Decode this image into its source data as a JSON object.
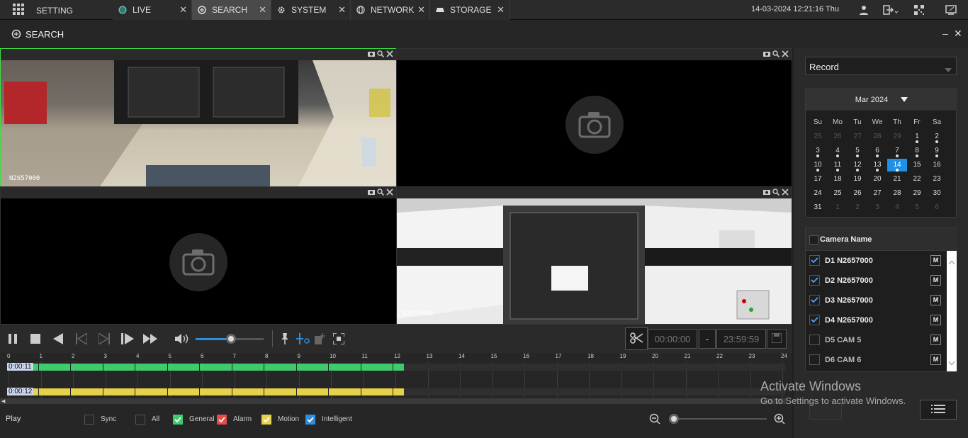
{
  "topbar": {
    "setting_label": "SETTING",
    "tabs": [
      {
        "label": "LIVE"
      },
      {
        "label": "SEARCH"
      },
      {
        "label": "SYSTEM"
      },
      {
        "label": "NETWORK"
      },
      {
        "label": "STORAGE"
      }
    ],
    "close_glyph": "✕",
    "datetime": "14-03-2024 12:21:16 Thu"
  },
  "title": "SEARCH",
  "window_controls": {
    "minimize": "–",
    "close": "✕"
  },
  "video": {
    "cell1_osd": "N2657000",
    "cell4_osd": "N2657000"
  },
  "playback": {
    "start_time": "00:00:00",
    "separator": "-",
    "end_time": "23:59:59"
  },
  "timeline": {
    "hours": [
      "0",
      "1",
      "2",
      "3",
      "4",
      "5",
      "6",
      "7",
      "8",
      "9",
      "10",
      "11",
      "12",
      "13",
      "14",
      "15",
      "16",
      "17",
      "18",
      "19",
      "20",
      "21",
      "22",
      "23",
      "24"
    ],
    "row1_label": "0:00:11",
    "row2_label": "0:00:12",
    "row1_color": "#3ecb6e",
    "row2_color": "#e6d24a",
    "row1_end_hour": 12.35,
    "row2_end_hour": 12.35
  },
  "bottombar": {
    "play_label": "Play",
    "filters": [
      {
        "label": "Sync",
        "checked": false,
        "color": ""
      },
      {
        "label": "All",
        "checked": false,
        "color": ""
      },
      {
        "label": "General",
        "checked": true,
        "color": "#3ecb6e"
      },
      {
        "label": "Alarm",
        "checked": true,
        "color": "#e84a4a"
      },
      {
        "label": "Motion",
        "checked": true,
        "color": "#e6d24a"
      },
      {
        "label": "Intelligent",
        "checked": true,
        "color": "#2e8ede"
      }
    ],
    "zoom_level": 0
  },
  "right": {
    "record_type": "Record",
    "calendar": {
      "month": "Mar 2024",
      "weekdays": [
        "Su",
        "Mo",
        "Tu",
        "We",
        "Th",
        "Fr",
        "Sa"
      ],
      "weeks": [
        [
          "25",
          "26",
          "27",
          "28",
          "29",
          "1",
          "2"
        ],
        [
          "3",
          "4",
          "5",
          "6",
          "7",
          "8",
          "9"
        ],
        [
          "10",
          "11",
          "12",
          "13",
          "14",
          "15",
          "16"
        ],
        [
          "17",
          "18",
          "19",
          "20",
          "21",
          "22",
          "23"
        ],
        [
          "24",
          "25",
          "26",
          "27",
          "28",
          "29",
          "30"
        ],
        [
          "31",
          "1",
          "2",
          "3",
          "4",
          "5",
          "6"
        ]
      ],
      "selected_day": "14",
      "accent": "#1e90e6"
    },
    "camera_header": "Camera Name",
    "cameras": [
      {
        "name": "D1 N2657000",
        "checked": true,
        "m": "M"
      },
      {
        "name": "D2 N2657000",
        "checked": true,
        "m": "M"
      },
      {
        "name": "D3 N2657000",
        "checked": true,
        "m": "M"
      },
      {
        "name": "D4 N2657000",
        "checked": true,
        "m": "M"
      },
      {
        "name": "D5 CAM 5",
        "checked": false,
        "m": "M"
      },
      {
        "name": "D6 CAM 6",
        "checked": false,
        "m": "M"
      }
    ]
  },
  "watermark": {
    "title": "Activate Windows",
    "subtitle": "Go to Settings to activate Windows."
  }
}
